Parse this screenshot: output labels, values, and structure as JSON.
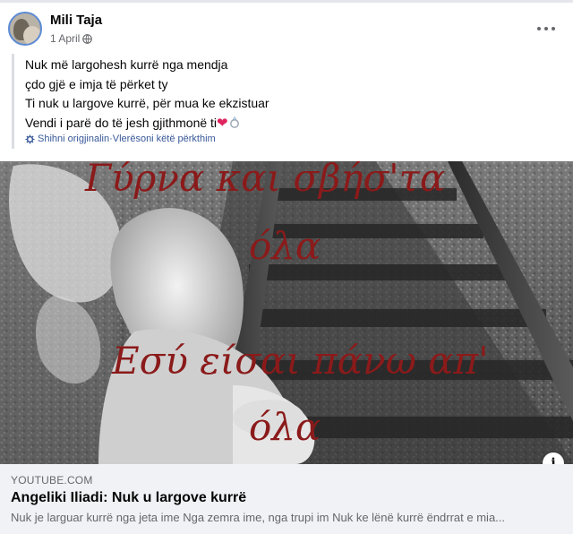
{
  "post": {
    "author": "Mili Taja",
    "date": "1 April",
    "audience_icon": "globe-icon",
    "text_lines": [
      "Nuk më largohesh kurrë nga mendja",
      "çdo gjë e imja të përket ty",
      "Ti nuk u largove kurrë, për mua ke ekzistuar",
      "Vendi i parë do të jesh gjithmonë ti"
    ],
    "translation_note": "Shihni origjinalin·Vlerësoni këtë përkthim"
  },
  "link_preview": {
    "domain": "YOUTUBE.COM",
    "title": "Angeliki Iliadi: Nuk u largove kurrë",
    "description": "Nuk je larguar kurrë nga jeta ime Nga zemra ime, nga trupi im Nuk ke lënë kurrë ëndrrat e mia..."
  },
  "image_overlay_text": [
    "Γύρνα και σβήσ'τα",
    "όλα",
    "Εσύ είσαι πάνω απ'",
    "όλα"
  ],
  "colors": {
    "link": "#385898",
    "overlay_text": "#8b1a1a",
    "heart": "#e0245e"
  }
}
